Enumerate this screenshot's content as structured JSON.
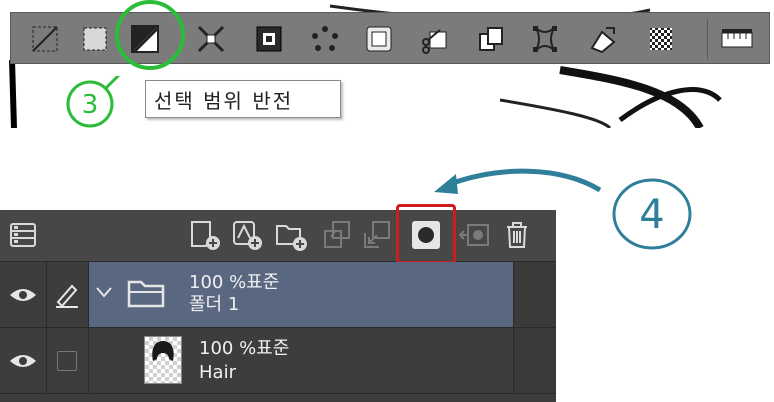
{
  "selection_launcher": {
    "tooltip": "선택 범위 반전",
    "annotation_number": "3",
    "buttons": [
      {
        "name": "clear-selection-icon"
      },
      {
        "name": "crop-selection-icon"
      },
      {
        "name": "invert-selection-icon"
      },
      {
        "name": "shrink-selection-icon"
      },
      {
        "name": "expand-selection-icon"
      },
      {
        "name": "scatter-selection-icon"
      },
      {
        "name": "convert-selection-icon"
      },
      {
        "name": "cut-paste-icon"
      },
      {
        "name": "copy-paste-icon"
      },
      {
        "name": "transform-icon"
      },
      {
        "name": "fill-icon"
      },
      {
        "name": "pattern-fill-icon"
      },
      {
        "name": "settings-ruler-icon"
      }
    ]
  },
  "layer_palette": {
    "annotation_number": "4",
    "toolbar_buttons": [
      {
        "name": "layer-property-icon"
      },
      {
        "name": "new-raster-layer-icon"
      },
      {
        "name": "new-vector-layer-icon"
      },
      {
        "name": "new-folder-icon"
      },
      {
        "name": "transfer-to-lower-layer-icon"
      },
      {
        "name": "combine-to-lower-layer-icon"
      },
      {
        "name": "create-layer-mask-icon"
      },
      {
        "name": "apply-mask-icon"
      },
      {
        "name": "delete-layer-icon"
      }
    ],
    "layers": [
      {
        "type": "folder",
        "blend": "100 %표준",
        "name": "폴더 1"
      },
      {
        "type": "raster",
        "blend": "100 %표준",
        "name": "Hair"
      }
    ]
  },
  "colors": {
    "annotation_green": "#2bbd3a",
    "annotation_teal": "#2f7f9a",
    "highlight_red": "#d01c1c",
    "folder_selected": "#5a6780"
  }
}
